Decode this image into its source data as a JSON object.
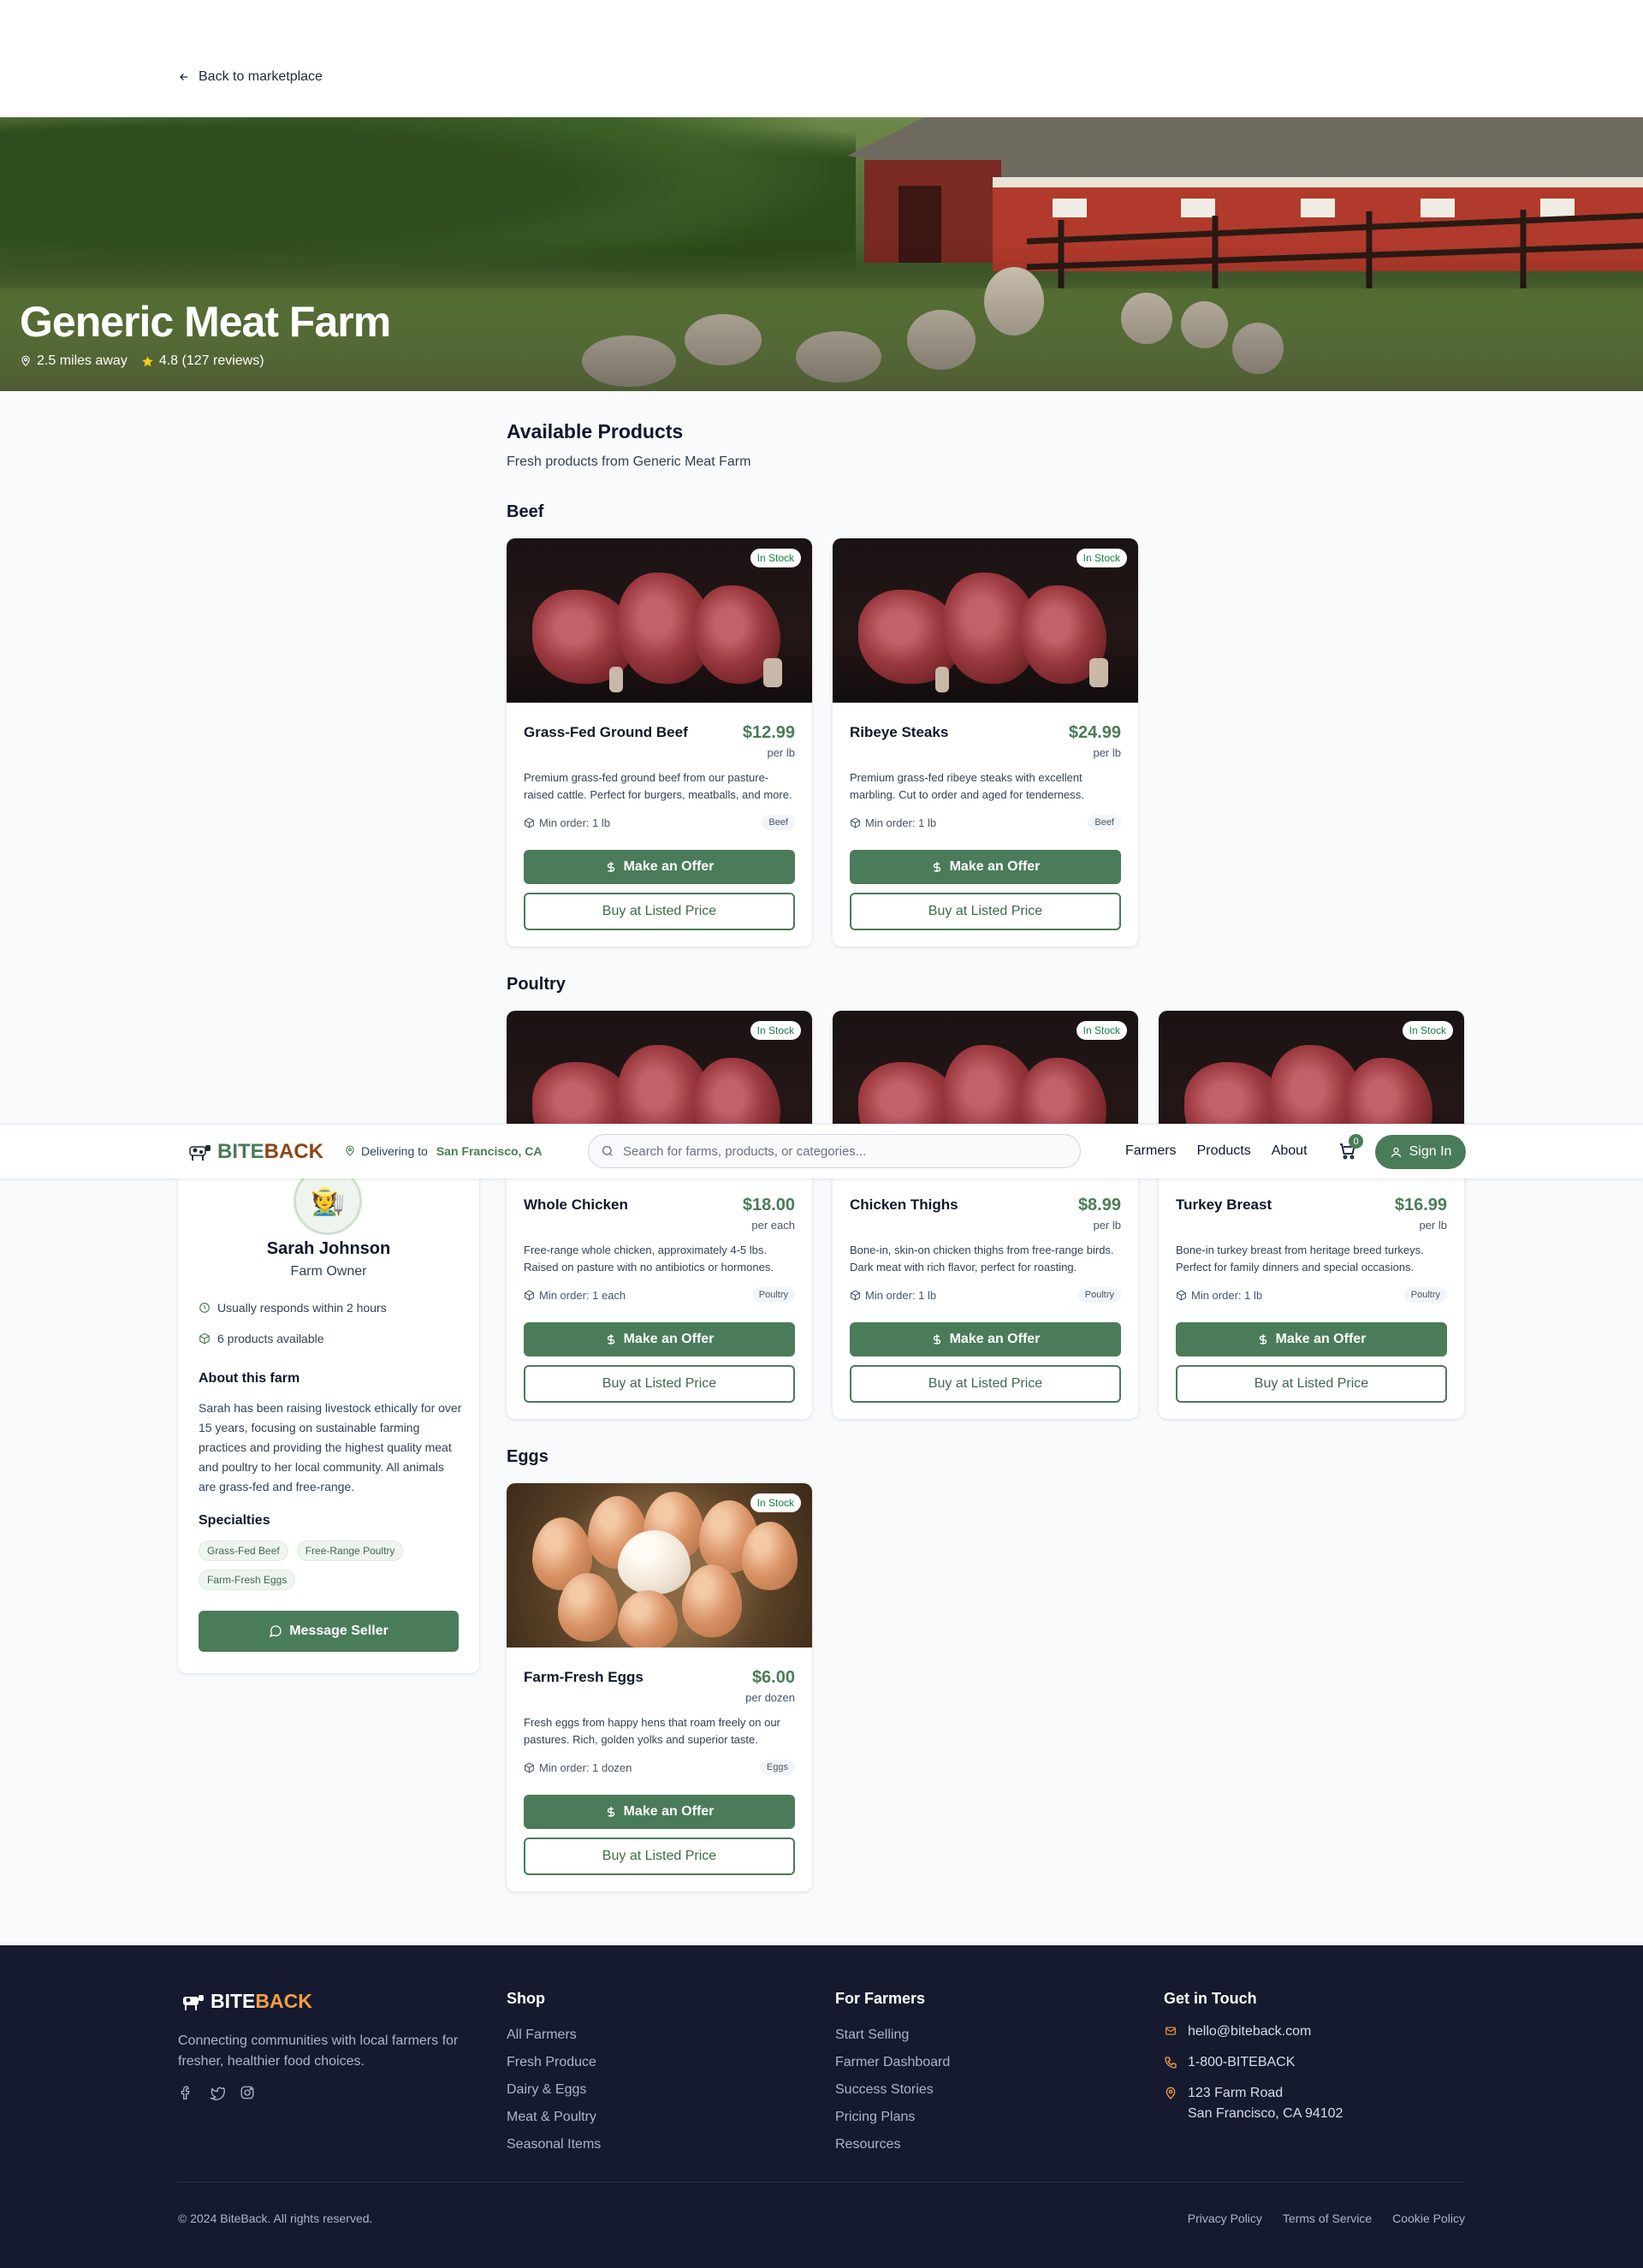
{
  "nav_back": "Back to marketplace",
  "farm": {
    "name": "Generic Meat Farm",
    "distance": "2.5 miles away",
    "rating": "4.8 (127 reviews)"
  },
  "products_section": {
    "title": "Available Products",
    "subtitle": "Fresh products from Generic Meat Farm"
  },
  "categories": [
    {
      "name": "Beef",
      "products": [
        {
          "badge": "In Stock",
          "name": "Grass-Fed Ground Beef",
          "price": "$12.99",
          "unit": "per lb",
          "desc": "Premium grass-fed ground beef from our pasture-raised cattle. Perfect for burgers, meatballs, and more.",
          "min_order": "Min order: 1 lb",
          "category": "Beef",
          "offer": "Make an Offer",
          "buy": "Buy at Listed Price"
        },
        {
          "badge": "In Stock",
          "name": "Ribeye Steaks",
          "price": "$24.99",
          "unit": "per lb",
          "desc": "Premium grass-fed ribeye steaks with excellent marbling. Cut to order and aged for tenderness.",
          "min_order": "Min order: 1 lb",
          "category": "Beef",
          "offer": "Make an Offer",
          "buy": "Buy at Listed Price"
        }
      ]
    },
    {
      "name": "Poultry",
      "products": [
        {
          "badge": "In Stock",
          "name": "Whole Chicken",
          "price": "$18.00",
          "unit": "per each",
          "desc": "Free-range whole chicken, approximately 4-5 lbs. Raised on pasture with no antibiotics or hormones.",
          "min_order": "Min order: 1 each",
          "category": "Poultry",
          "offer": "Make an Offer",
          "buy": "Buy at Listed Price"
        },
        {
          "badge": "In Stock",
          "name": "Chicken Thighs",
          "price": "$8.99",
          "unit": "per lb",
          "desc": "Bone-in, skin-on chicken thighs from free-range birds. Dark meat with rich flavor, perfect for roasting.",
          "min_order": "Min order: 1 lb",
          "category": "Poultry",
          "offer": "Make an Offer",
          "buy": "Buy at Listed Price"
        },
        {
          "badge": "In Stock",
          "name": "Turkey Breast",
          "price": "$16.99",
          "unit": "per lb",
          "desc": "Bone-in turkey breast from heritage breed turkeys. Perfect for family dinners and special occasions.",
          "min_order": "Min order: 1 lb",
          "category": "Poultry",
          "offer": "Make an Offer",
          "buy": "Buy at Listed Price"
        }
      ]
    },
    {
      "name": "Eggs",
      "products": [
        {
          "badge": "In Stock",
          "name": "Farm-Fresh Eggs",
          "price": "$6.00",
          "unit": "per dozen",
          "desc": "Fresh eggs from happy hens that roam freely on our pastures. Rich, golden yolks and superior taste.",
          "min_order": "Min order: 1 dozen",
          "category": "Eggs",
          "offer": "Make an Offer",
          "buy": "Buy at Listed Price"
        }
      ]
    }
  ],
  "header": {
    "logo_part1": "BITE",
    "logo_part2": "BACK",
    "delivering_label": "Delivering to",
    "delivering_location": "San Francisco, CA",
    "search_placeholder": "Search for farms, products, or categories...",
    "nav": [
      "Farmers",
      "Products",
      "About"
    ],
    "cart_count": "0",
    "sign_in": "Sign In"
  },
  "seller": {
    "name": "Sarah Johnson",
    "role": "Farm Owner",
    "response": "Usually responds within 2 hours",
    "products_available": "6 products available",
    "about_title": "About this farm",
    "about": "Sarah has been raising livestock ethically for over 15 years, focusing on sustainable farming practices and providing the highest quality meat and poultry to her local community. All animals are grass-fed and free-range.",
    "specialties_title": "Specialties",
    "specialties": [
      "Grass-Fed Beef",
      "Free-Range Poultry",
      "Farm-Fresh Eggs"
    ],
    "message_button": "Message Seller"
  },
  "footer": {
    "logo_part1": "BITE",
    "logo_part2": "BACK",
    "tagline": "Connecting communities with local farmers for fresher, healthier food choices.",
    "shop_title": "Shop",
    "shop_links": [
      "All Farmers",
      "Fresh Produce",
      "Dairy & Eggs",
      "Meat & Poultry",
      "Seasonal Items"
    ],
    "farmers_title": "For Farmers",
    "farmers_links": [
      "Start Selling",
      "Farmer Dashboard",
      "Success Stories",
      "Pricing Plans",
      "Resources"
    ],
    "contact_title": "Get in Touch",
    "email": "hello@biteback.com",
    "phone": "1-800-BITEBACK",
    "address_line1": "123 Farm Road",
    "address_line2": "San Francisco, CA 94102",
    "copyright": "© 2024 BiteBack. All rights reserved.",
    "legal_links": [
      "Privacy Policy",
      "Terms of Service",
      "Cookie Policy"
    ]
  },
  "colors": {
    "primary_green": "#4a7c59",
    "brand_brown": "#8b4513",
    "footer_bg": "#151a2e",
    "footer_accent": "#f59e42",
    "in_stock": "#15803d"
  }
}
